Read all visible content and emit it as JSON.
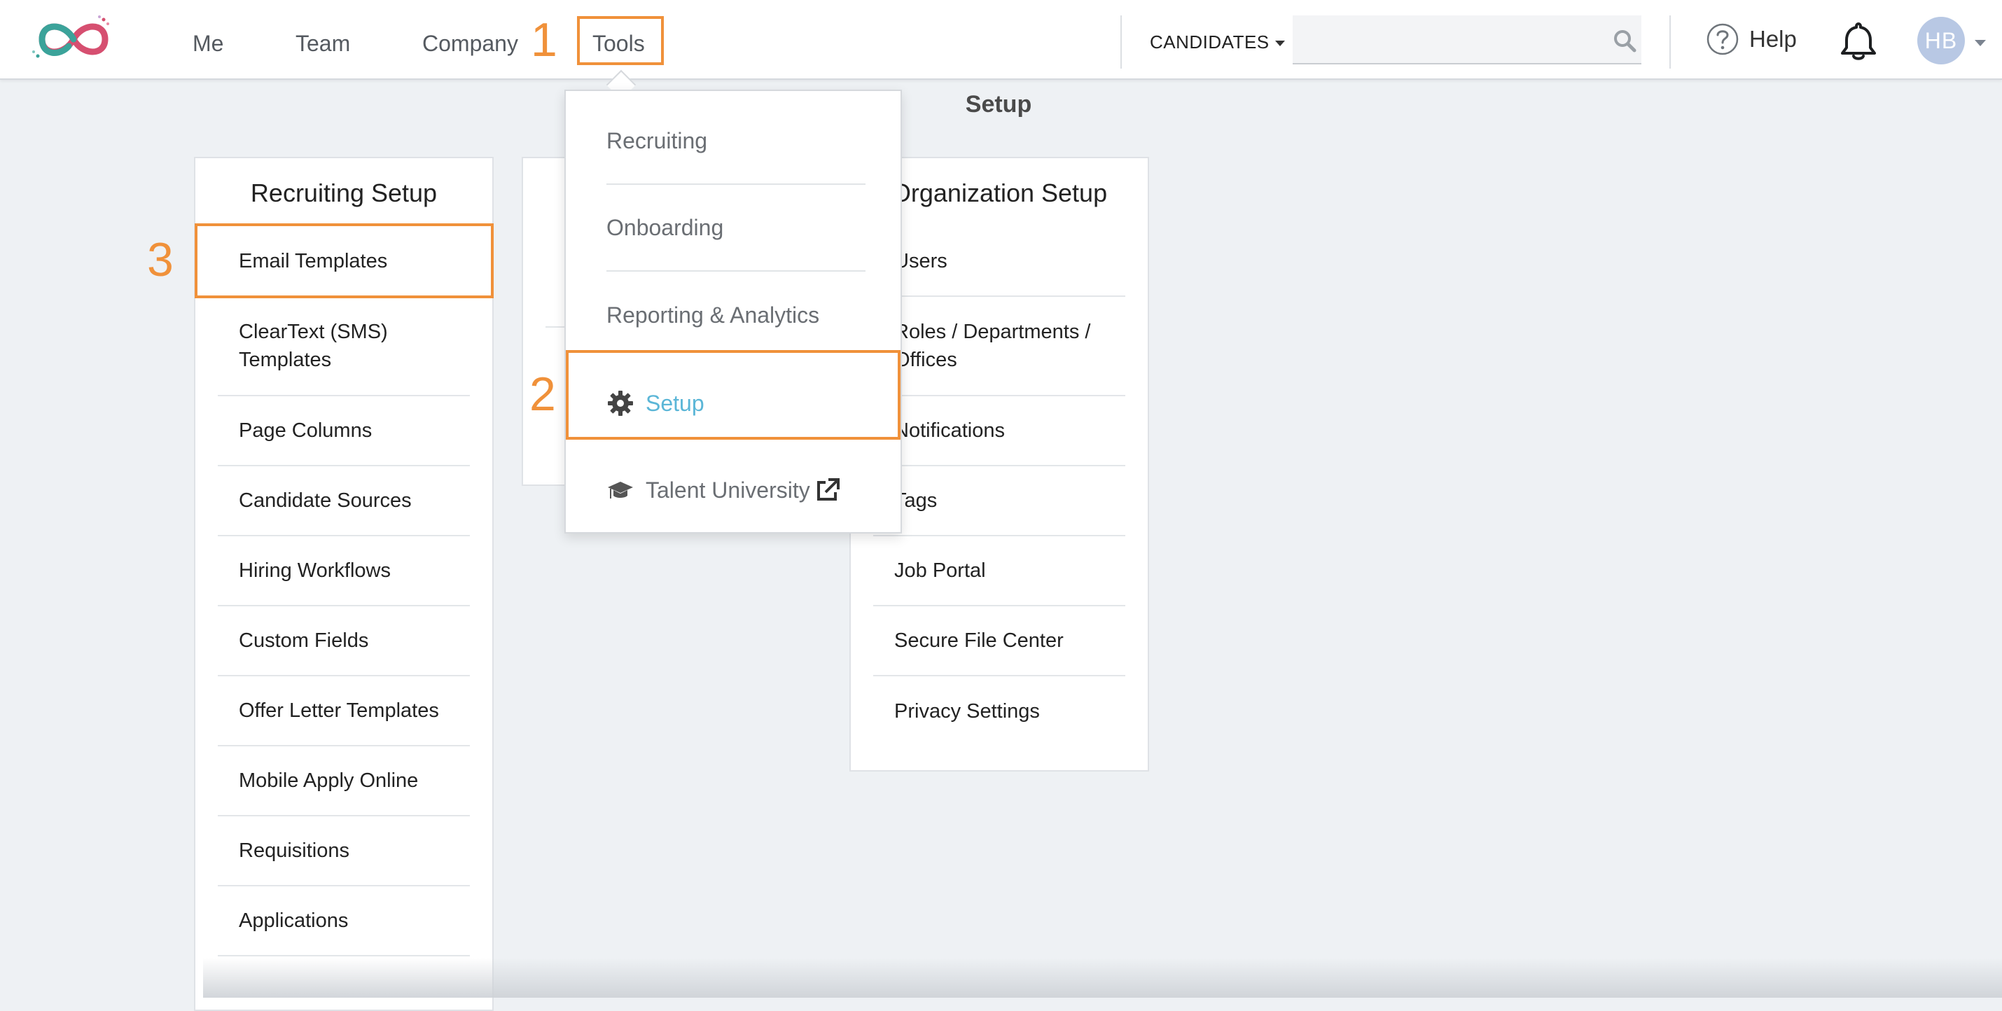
{
  "nav": {
    "items": [
      "Me",
      "Team",
      "Company",
      "Tools"
    ],
    "candidates_label": "CANDIDATES",
    "search_placeholder": "",
    "help_label": "Help",
    "avatar_initials": "HB"
  },
  "annotations": {
    "step1": "1",
    "step2": "2",
    "step3": "3",
    "color": "#f0913a"
  },
  "page": {
    "title": "Setup"
  },
  "tools_menu": {
    "items": [
      "Recruiting",
      "Onboarding",
      "Reporting & Analytics",
      "Setup",
      "Talent University"
    ],
    "active_color": "#5bb6d7"
  },
  "recruiting_setup": {
    "title": "Recruiting Setup",
    "items": [
      "Email Templates",
      "ClearText (SMS) Templates",
      "Page Columns",
      "Candidate Sources",
      "Hiring Workflows",
      "Custom Fields",
      "Offer Letter Templates",
      "Mobile Apply Online",
      "Requisitions",
      "Applications"
    ]
  },
  "organization_setup": {
    "title": "Organization Setup",
    "items": [
      "Users",
      "Roles / Departments / Offices",
      "Notifications",
      "Tags",
      "Job Portal",
      "Secure File Center",
      "Privacy Settings"
    ]
  },
  "icons": {
    "logo": "infinity-logo",
    "search": "search-icon",
    "help": "question-circle-icon",
    "bell": "bell-icon",
    "gear": "gear-icon",
    "graduation": "graduation-cap-icon",
    "external": "external-link-icon"
  }
}
